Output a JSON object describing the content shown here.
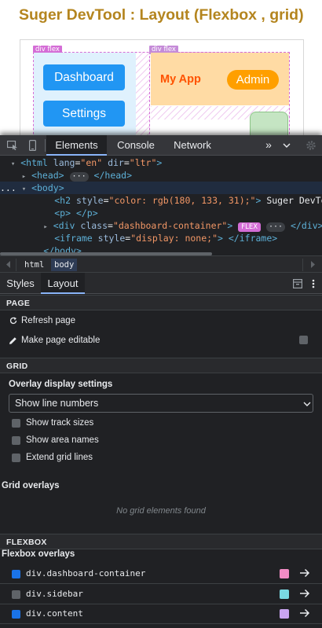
{
  "webpage": {
    "title": "Suger DevTool : Layout (Flexbox , grid)",
    "flex_tag_container": "div flex",
    "flex_tag_content": "div flex",
    "sidebar_buttons": [
      "Dashboard",
      "Settings"
    ],
    "app_name": "My App",
    "admin_button": "Admin"
  },
  "devtools": {
    "tabs": [
      "Elements",
      "Console",
      "Network"
    ],
    "active_tab": "Elements",
    "more_tabs_label": "»",
    "dom": {
      "html_line": {
        "tag_open": "<html",
        "attrs": [
          {
            "name": "lang",
            "value": "\"en\""
          },
          {
            "name": "dir",
            "value": "\"ltr\""
          }
        ],
        "tag_close": ">"
      },
      "head_line": {
        "open": "<head>",
        "ellipsis": "···",
        "close": "</head>"
      },
      "body_line": {
        "prefix": "...",
        "open": "<body>"
      },
      "h2_line": {
        "open": "<h2",
        "attr": "style",
        "value": "\"color: rgb(180, 133, 31);\"",
        "close": ">",
        "text": " Suger DevTool"
      },
      "p_line": {
        "text": "<p> </p>"
      },
      "div_line": {
        "open": "<div",
        "attr": "class",
        "value": "\"dashboard-container\"",
        "close": ">",
        "badge": "FLEX",
        "ellipsis": "···",
        "end": "</div>"
      },
      "iframe_line": {
        "open": "<iframe",
        "attr": "style",
        "value": "\"display: none;\"",
        "close": ">",
        "end": "</iframe>"
      },
      "body_close": "</body>"
    },
    "breadcrumbs": [
      "html",
      "body"
    ],
    "sub_tabs": [
      "Styles",
      "Layout"
    ],
    "active_sub_tab": "Layout",
    "page_section": {
      "heading": "PAGE",
      "refresh": "Refresh page",
      "editable": "Make page editable"
    },
    "grid_section": {
      "heading": "GRID",
      "overlay_settings": "Overlay display settings",
      "select_value": "Show line numbers",
      "options": [
        "Show track sizes",
        "Show area names",
        "Extend grid lines"
      ],
      "overlays_title": "Grid overlays",
      "empty_message": "No grid elements found"
    },
    "flexbox_section": {
      "heading": "FLEXBOX",
      "overlays_title": "Flexbox overlays",
      "items": [
        {
          "label": "div.dashboard-container",
          "checked": true,
          "color": "#f28cc5"
        },
        {
          "label": "div.sidebar",
          "checked": false,
          "color": "#7ad9e3"
        },
        {
          "label": "div.content",
          "checked": true,
          "color": "#c9a4f0"
        }
      ]
    }
  }
}
